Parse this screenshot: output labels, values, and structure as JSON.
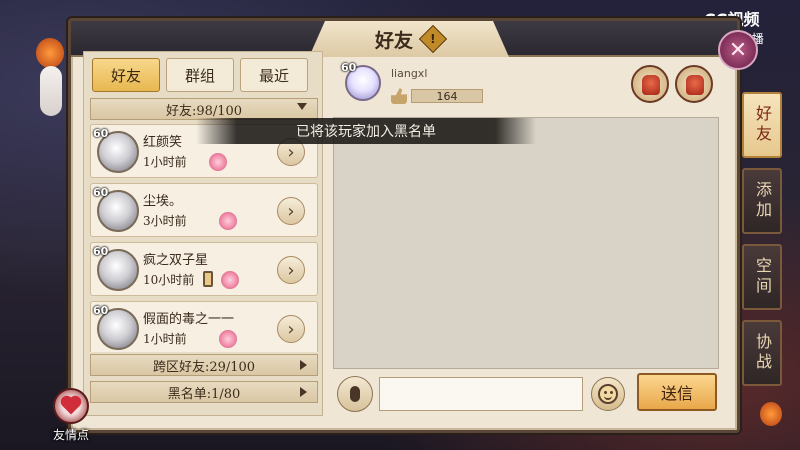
{
  "title": "好友",
  "watermark": {
    "line1": "CC视频",
    "line2": "CC直播"
  },
  "tabs": [
    {
      "label": "好友",
      "active": true
    },
    {
      "label": "群组",
      "active": false
    },
    {
      "label": "最近",
      "active": false
    }
  ],
  "friend_count": "好友:98/100",
  "friends": [
    {
      "level": "60",
      "name": "红颜笑",
      "time": "1小时前"
    },
    {
      "level": "60",
      "name": "尘埃。",
      "time": "3小时前"
    },
    {
      "level": "60",
      "name": "疯之双子星",
      "time": "10小时前"
    },
    {
      "level": "60",
      "name": "假面的毒之一一",
      "time": "1小时前"
    }
  ],
  "cross_server": "跨区好友:29/100",
  "blacklist": "黑名单:1/80",
  "profile": {
    "level": "60",
    "name": "liangxl",
    "likes": "164"
  },
  "toast": "已将该玩家加入黑名单",
  "send_label": "送信",
  "side_tabs": [
    {
      "label": "好友",
      "active": true
    },
    {
      "label": "添加",
      "active": false
    },
    {
      "label": "空间",
      "active": false
    },
    {
      "label": "协战",
      "active": false
    }
  ],
  "bond_label": "友情点",
  "colors": {
    "accent": "#e9a84a",
    "panel": "#efe6d6",
    "title_bar": "#2b2831"
  }
}
